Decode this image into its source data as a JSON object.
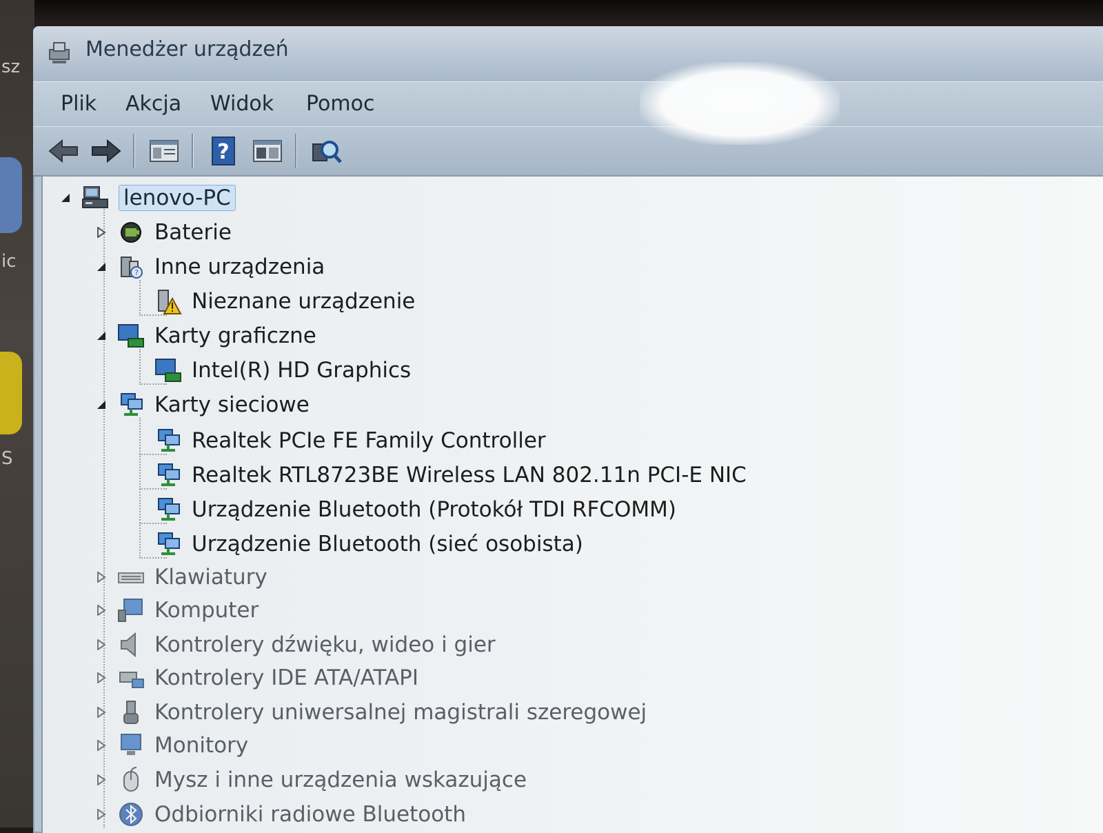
{
  "desktop": {
    "fragments": [
      "sz",
      "ic",
      "S"
    ]
  },
  "window": {
    "title": "Menedżer urządzeń"
  },
  "menu": {
    "items": [
      "Plik",
      "Akcja",
      "Widok",
      "Pomoc"
    ]
  },
  "toolbar": {
    "buttons": [
      "back-arrow-icon",
      "forward-arrow-icon",
      "properties-icon",
      "help-icon",
      "update-driver-icon",
      "scan-hardware-icon"
    ]
  },
  "colors": {
    "accent": "#3b78c2",
    "warning": "#f2c21a",
    "network": "#2f8f3a"
  },
  "tree": {
    "root": "lenovo-PC",
    "categories": [
      {
        "label": "Baterie",
        "expanded": false,
        "icon": "battery-icon"
      },
      {
        "label": "Inne urządzenia",
        "expanded": true,
        "icon": "other-devices-icon",
        "children": [
          {
            "label": "Nieznane urządzenie",
            "icon": "unknown-device-warning-icon"
          }
        ]
      },
      {
        "label": "Karty graficzne",
        "expanded": true,
        "icon": "display-adapter-icon",
        "children": [
          {
            "label": "Intel(R) HD Graphics",
            "icon": "display-adapter-icon"
          }
        ]
      },
      {
        "label": "Karty sieciowe",
        "expanded": true,
        "icon": "network-adapter-icon",
        "children": [
          {
            "label": "Realtek PCIe FE Family Controller",
            "icon": "network-adapter-icon"
          },
          {
            "label": "Realtek RTL8723BE Wireless LAN 802.11n PCI-E NIC",
            "icon": "network-adapter-icon"
          },
          {
            "label": "Urządzenie Bluetooth (Protokół TDI RFCOMM)",
            "icon": "network-adapter-icon"
          },
          {
            "label": "Urządzenie Bluetooth (sieć osobista)",
            "icon": "network-adapter-icon"
          }
        ]
      },
      {
        "label": "Klawiatury",
        "expanded": false,
        "icon": "keyboard-icon"
      },
      {
        "label": "Komputer",
        "expanded": false,
        "icon": "computer-icon"
      },
      {
        "label": "Kontrolery dźwięku, wideo i gier",
        "expanded": false,
        "icon": "speaker-icon"
      },
      {
        "label": "Kontrolery IDE ATA/ATAPI",
        "expanded": false,
        "icon": "ide-controller-icon"
      },
      {
        "label": "Kontrolery uniwersalnej magistrali szeregowej",
        "expanded": false,
        "icon": "usb-icon"
      },
      {
        "label": "Monitory",
        "expanded": false,
        "icon": "monitor-icon"
      },
      {
        "label": "Mysz i inne urządzenia wskazujące",
        "expanded": false,
        "icon": "mouse-icon"
      },
      {
        "label": "Odbiorniki radiowe Bluetooth",
        "expanded": false,
        "icon": "bluetooth-icon"
      }
    ]
  }
}
